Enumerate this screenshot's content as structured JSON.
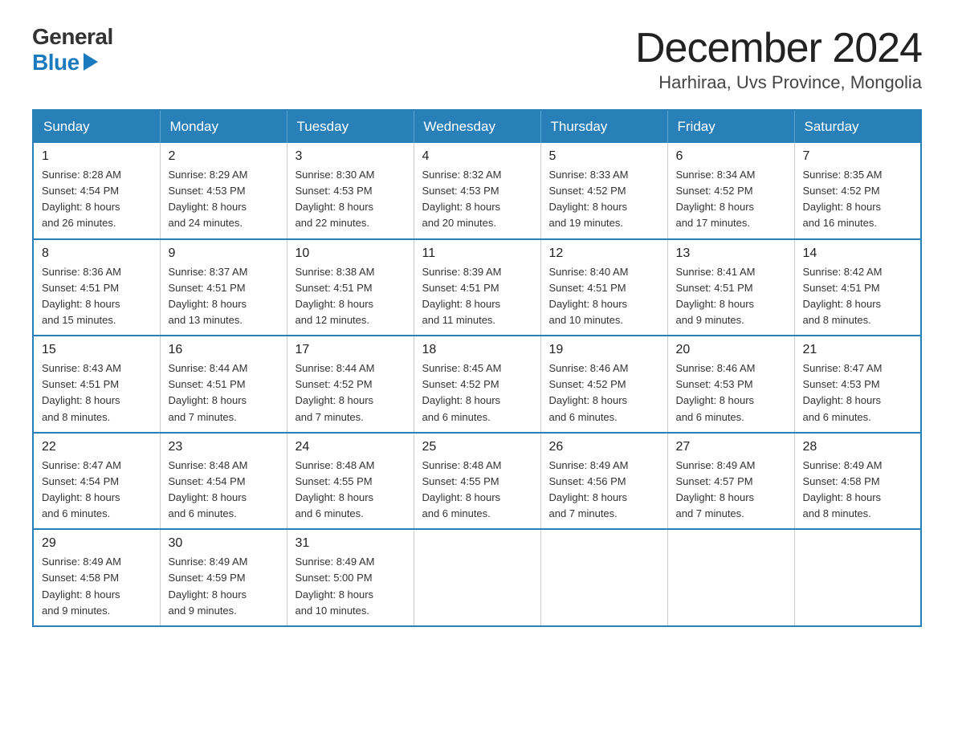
{
  "header": {
    "logo_general": "General",
    "logo_blue": "Blue",
    "month_title": "December 2024",
    "location": "Harhiraa, Uvs Province, Mongolia"
  },
  "days_of_week": [
    "Sunday",
    "Monday",
    "Tuesday",
    "Wednesday",
    "Thursday",
    "Friday",
    "Saturday"
  ],
  "weeks": [
    [
      {
        "day": "1",
        "sunrise": "8:28 AM",
        "sunset": "4:54 PM",
        "daylight": "8 hours and 26 minutes."
      },
      {
        "day": "2",
        "sunrise": "8:29 AM",
        "sunset": "4:53 PM",
        "daylight": "8 hours and 24 minutes."
      },
      {
        "day": "3",
        "sunrise": "8:30 AM",
        "sunset": "4:53 PM",
        "daylight": "8 hours and 22 minutes."
      },
      {
        "day": "4",
        "sunrise": "8:32 AM",
        "sunset": "4:53 PM",
        "daylight": "8 hours and 20 minutes."
      },
      {
        "day": "5",
        "sunrise": "8:33 AM",
        "sunset": "4:52 PM",
        "daylight": "8 hours and 19 minutes."
      },
      {
        "day": "6",
        "sunrise": "8:34 AM",
        "sunset": "4:52 PM",
        "daylight": "8 hours and 17 minutes."
      },
      {
        "day": "7",
        "sunrise": "8:35 AM",
        "sunset": "4:52 PM",
        "daylight": "8 hours and 16 minutes."
      }
    ],
    [
      {
        "day": "8",
        "sunrise": "8:36 AM",
        "sunset": "4:51 PM",
        "daylight": "8 hours and 15 minutes."
      },
      {
        "day": "9",
        "sunrise": "8:37 AM",
        "sunset": "4:51 PM",
        "daylight": "8 hours and 13 minutes."
      },
      {
        "day": "10",
        "sunrise": "8:38 AM",
        "sunset": "4:51 PM",
        "daylight": "8 hours and 12 minutes."
      },
      {
        "day": "11",
        "sunrise": "8:39 AM",
        "sunset": "4:51 PM",
        "daylight": "8 hours and 11 minutes."
      },
      {
        "day": "12",
        "sunrise": "8:40 AM",
        "sunset": "4:51 PM",
        "daylight": "8 hours and 10 minutes."
      },
      {
        "day": "13",
        "sunrise": "8:41 AM",
        "sunset": "4:51 PM",
        "daylight": "8 hours and 9 minutes."
      },
      {
        "day": "14",
        "sunrise": "8:42 AM",
        "sunset": "4:51 PM",
        "daylight": "8 hours and 8 minutes."
      }
    ],
    [
      {
        "day": "15",
        "sunrise": "8:43 AM",
        "sunset": "4:51 PM",
        "daylight": "8 hours and 8 minutes."
      },
      {
        "day": "16",
        "sunrise": "8:44 AM",
        "sunset": "4:51 PM",
        "daylight": "8 hours and 7 minutes."
      },
      {
        "day": "17",
        "sunrise": "8:44 AM",
        "sunset": "4:52 PM",
        "daylight": "8 hours and 7 minutes."
      },
      {
        "day": "18",
        "sunrise": "8:45 AM",
        "sunset": "4:52 PM",
        "daylight": "8 hours and 6 minutes."
      },
      {
        "day": "19",
        "sunrise": "8:46 AM",
        "sunset": "4:52 PM",
        "daylight": "8 hours and 6 minutes."
      },
      {
        "day": "20",
        "sunrise": "8:46 AM",
        "sunset": "4:53 PM",
        "daylight": "8 hours and 6 minutes."
      },
      {
        "day": "21",
        "sunrise": "8:47 AM",
        "sunset": "4:53 PM",
        "daylight": "8 hours and 6 minutes."
      }
    ],
    [
      {
        "day": "22",
        "sunrise": "8:47 AM",
        "sunset": "4:54 PM",
        "daylight": "8 hours and 6 minutes."
      },
      {
        "day": "23",
        "sunrise": "8:48 AM",
        "sunset": "4:54 PM",
        "daylight": "8 hours and 6 minutes."
      },
      {
        "day": "24",
        "sunrise": "8:48 AM",
        "sunset": "4:55 PM",
        "daylight": "8 hours and 6 minutes."
      },
      {
        "day": "25",
        "sunrise": "8:48 AM",
        "sunset": "4:55 PM",
        "daylight": "8 hours and 6 minutes."
      },
      {
        "day": "26",
        "sunrise": "8:49 AM",
        "sunset": "4:56 PM",
        "daylight": "8 hours and 7 minutes."
      },
      {
        "day": "27",
        "sunrise": "8:49 AM",
        "sunset": "4:57 PM",
        "daylight": "8 hours and 7 minutes."
      },
      {
        "day": "28",
        "sunrise": "8:49 AM",
        "sunset": "4:58 PM",
        "daylight": "8 hours and 8 minutes."
      }
    ],
    [
      {
        "day": "29",
        "sunrise": "8:49 AM",
        "sunset": "4:58 PM",
        "daylight": "8 hours and 9 minutes."
      },
      {
        "day": "30",
        "sunrise": "8:49 AM",
        "sunset": "4:59 PM",
        "daylight": "8 hours and 9 minutes."
      },
      {
        "day": "31",
        "sunrise": "8:49 AM",
        "sunset": "5:00 PM",
        "daylight": "8 hours and 10 minutes."
      },
      null,
      null,
      null,
      null
    ]
  ],
  "labels": {
    "sunrise_prefix": "Sunrise: ",
    "sunset_prefix": "Sunset: ",
    "daylight_prefix": "Daylight: "
  }
}
